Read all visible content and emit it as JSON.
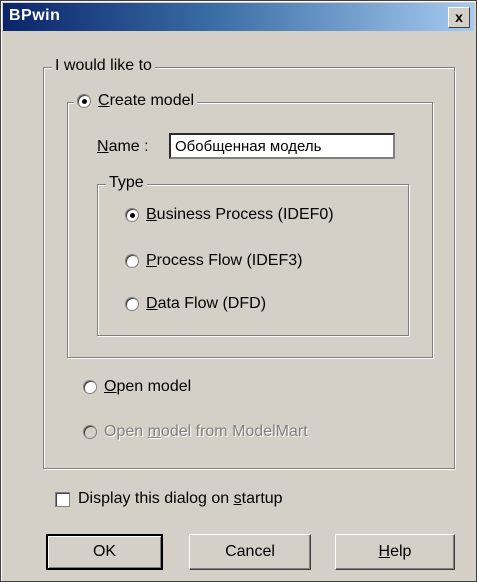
{
  "window": {
    "title": "BPwin",
    "close_label": "x"
  },
  "action_group": {
    "legend": "I would like to",
    "create_model": {
      "label_prefix": "",
      "mnemonic": "C",
      "label_rest": "reate model",
      "checked": true
    },
    "name_field": {
      "mnemonic": "N",
      "label_rest": "ame :",
      "value": "Обобщенная модель"
    },
    "type_group": {
      "legend": "Type",
      "options": [
        {
          "mnemonic": "B",
          "label_rest": "usiness Process (IDEF0)",
          "checked": true
        },
        {
          "mnemonic": "P",
          "label_rest": "rocess Flow (IDEF3)",
          "checked": false
        },
        {
          "mnemonic": "D",
          "label_rest": "ata Flow (DFD)",
          "checked": false
        }
      ]
    },
    "open_model": {
      "mnemonic": "O",
      "label_rest": "pen model",
      "checked": false
    },
    "open_modelmart": {
      "part1": "Open ",
      "mnemonic": "m",
      "part2": "odel from ModelMart",
      "enabled": false
    }
  },
  "startup_checkbox": {
    "part1": "Display this dialog on ",
    "mnemonic": "s",
    "part2": "tartup",
    "checked": false
  },
  "buttons": {
    "ok": "OK",
    "cancel": "Cancel",
    "help_mnemonic": "H",
    "help_rest": "elp"
  }
}
